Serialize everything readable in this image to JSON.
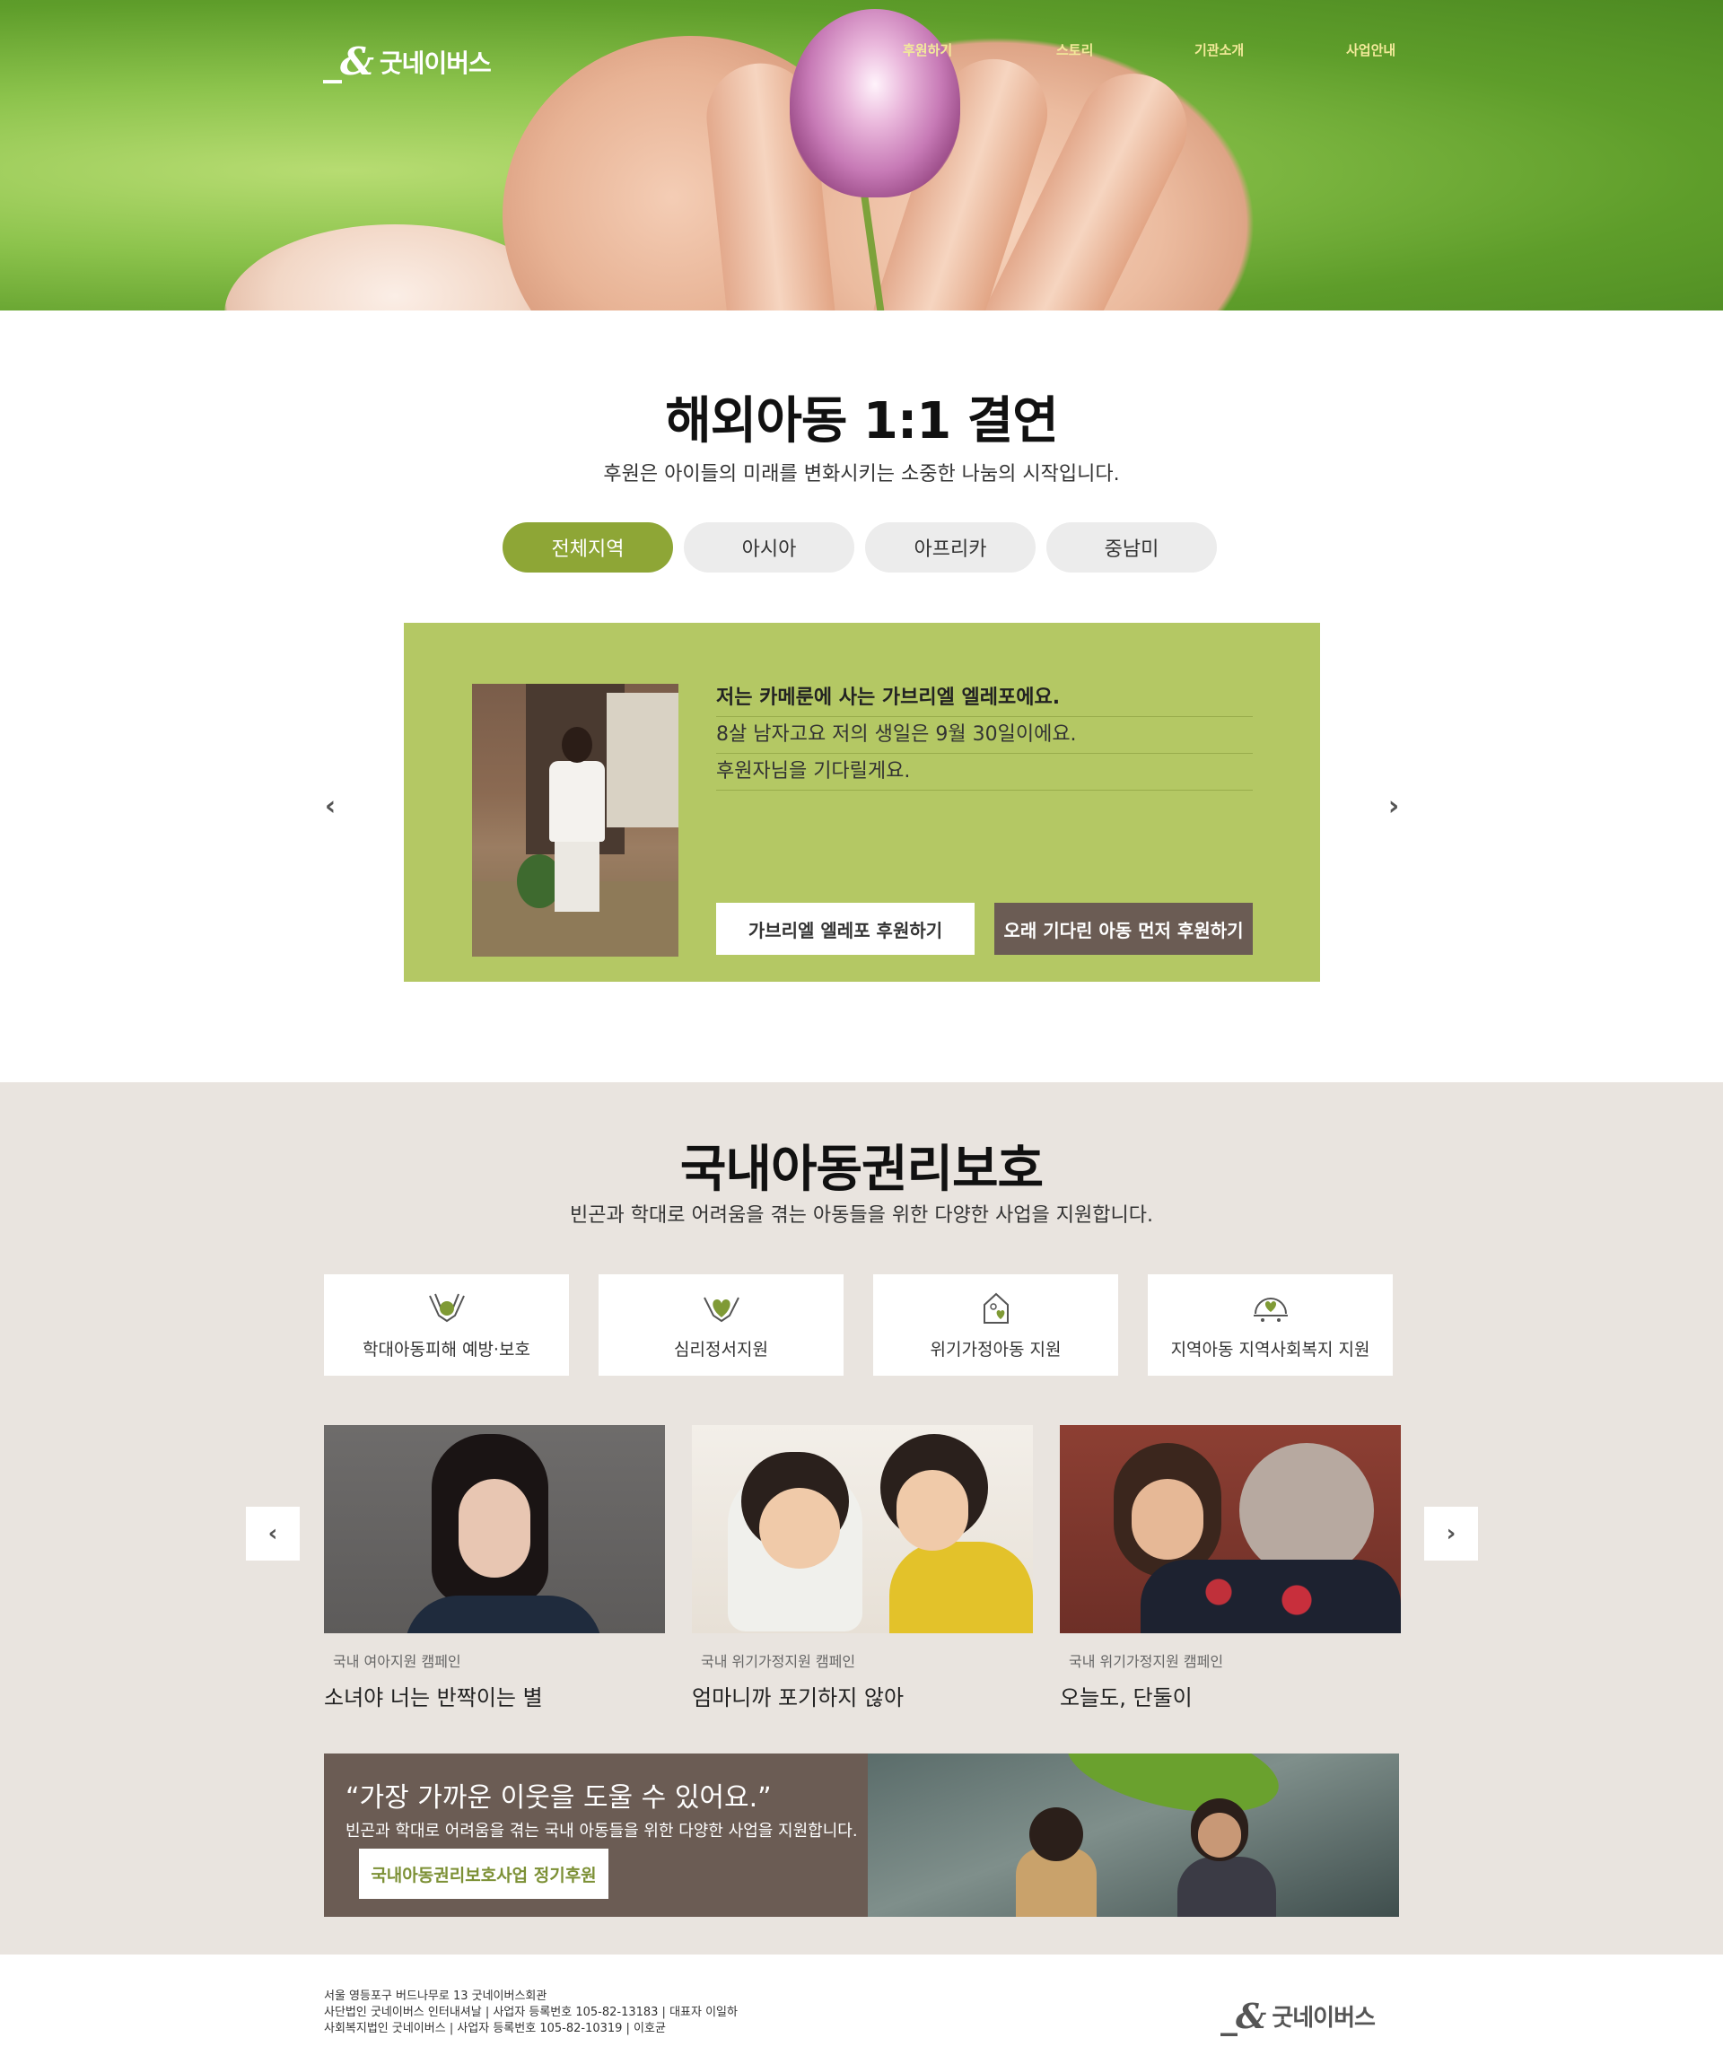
{
  "header": {
    "logo_mark": "_&",
    "logo_text": "굿네이버스",
    "nav": [
      "후원하기",
      "스토리",
      "기관소개",
      "사업안내"
    ]
  },
  "overseas": {
    "title": "해외아동 1:1 결연",
    "subtitle": "후원은 아이들의 미래를 변화시키는 소중한 나눔의 시작입니다.",
    "tabs": [
      "전체지역",
      "아시아",
      "아프리카",
      "중남미"
    ],
    "active_tab": "전체지역",
    "child": {
      "lines": [
        "저는 카메룬에 사는 가브리엘 엘레포에요.",
        "8살 남자고요 저의 생일은 9월 30일이에요.",
        "후원자님을 기다릴게요."
      ],
      "sponsor_button": "가브리엘 엘레포 후원하기",
      "waiting_button": "오래 기다린 아동 먼저 후원하기"
    }
  },
  "domestic": {
    "title": "국내아동권리보호",
    "subtitle": "빈곤과 학대로 어려움을 겪는 아동들을 위한 다양한 사업을 지원합니다.",
    "categories": [
      {
        "label": "학대아동피해 예방·보호",
        "icon": "hands-heart-icon"
      },
      {
        "label": "심리정서지원",
        "icon": "heart-hands-icon"
      },
      {
        "label": "위기가정아동 지원",
        "icon": "house-heart-icon"
      },
      {
        "label": "지역아동 지역사회복지 지원",
        "icon": "community-heart-icon"
      }
    ],
    "campaigns": [
      {
        "tag": "국내 여아지원 캠페인",
        "title": "소녀야 너는 반짝이는 별"
      },
      {
        "tag": "국내 위기가정지원 캠페인",
        "title": "엄마니까 포기하지 않아"
      },
      {
        "tag": "국내 위기가정지원 캠페인",
        "title": "오늘도, 단둘이"
      }
    ],
    "banner": {
      "quote": "“가장 가까운 이웃을 도울 수 있어요.”",
      "desc": "빈곤과 학대로 어려움을 겪는 국내 아동들을 위한 다양한 사업을 지원합니다.",
      "button": "국내아동권리보호사업 정기후원"
    }
  },
  "footer": {
    "lines": [
      "서울 영등포구 버드나무로 13 굿네이버스회관",
      "사단법인 굿네이버스 인터내셔날 | 사업자 등록번호 105-82-13183 | 대표자 이일하",
      "사회복지법인 굿네이버스 | 사업자 등록번호 105-82-10319 | 이호균"
    ]
  },
  "colors": {
    "accent_green": "#8ea636",
    "card_green": "#b4c864",
    "brown": "#6b5c54",
    "beige_bg": "#e9e4df"
  }
}
